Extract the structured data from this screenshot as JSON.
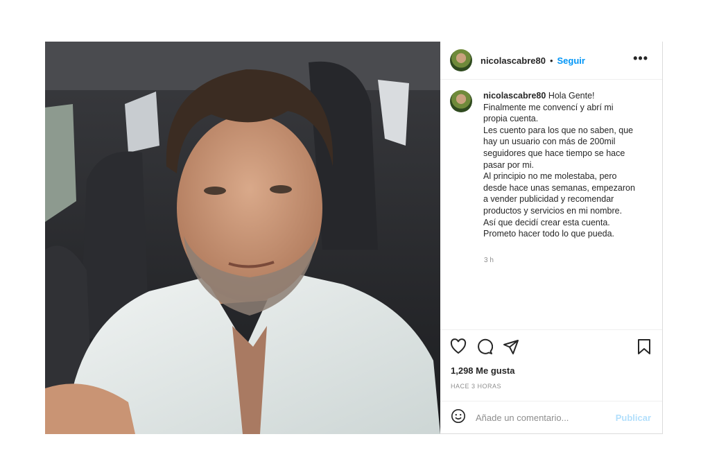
{
  "post": {
    "username": "nicolascabre80",
    "separator": "•",
    "follow_label": "Seguir",
    "more_label": "•••",
    "caption": {
      "username": "nicolascabre80",
      "lines": [
        "Hola Gente!",
        "Finalmente me convencí y abrí mi",
        "propia cuenta.",
        "Les cuento para los que no saben, que",
        "hay un usuario con más de 200mil",
        "seguidores que hace tiempo se hace",
        "pasar por mi.",
        "Al principio no me molestaba, pero",
        "desde hace unas semanas, empezaron",
        "a vender publicidad y recomendar",
        "productos y servicios en mi nombre.",
        "Así que decidí crear esta cuenta.",
        "Prometo hacer todo lo que pueda."
      ],
      "time": "3 h"
    },
    "likes": "1,298 Me gusta",
    "time_ago": "HACE 3 HORAS",
    "comment": {
      "placeholder": "Añade un comentario...",
      "publish_label": "Publicar"
    },
    "icons": {
      "like": "heart-icon",
      "comment": "comment-icon",
      "share": "send-icon",
      "save": "bookmark-icon",
      "emoji": "smiley-icon"
    },
    "colors": {
      "link": "#0095f6",
      "publish_disabled": "#b2dffc",
      "secondary_text": "#8e8e8e"
    }
  }
}
